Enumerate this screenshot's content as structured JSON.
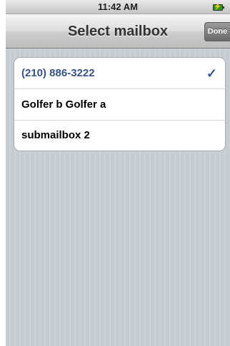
{
  "status_bar": {
    "time": "11:42 AM",
    "battery_icon": "battery-charging-icon"
  },
  "nav": {
    "title": "Select mailbox",
    "done_label": "Done"
  },
  "mailboxes": [
    {
      "label": "(210) 886-3222",
      "selected": true
    },
    {
      "label": "Golfer b Golfer a",
      "selected": false
    },
    {
      "label": "submailbox 2",
      "selected": false
    }
  ],
  "colors": {
    "selected_text": "#385487",
    "background": "#c5ccd4"
  },
  "checkmark_glyph": "✓"
}
